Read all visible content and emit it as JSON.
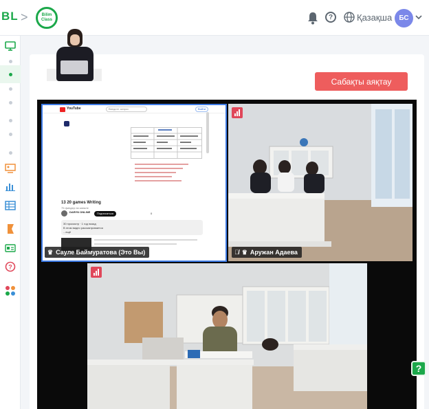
{
  "header": {
    "bl_logo": "BL",
    "breadcrumb_separator": ">",
    "bilim_logo_line1": "Bilim",
    "bilim_logo_line2": "Class",
    "help_glyph": "?",
    "language": "Қазақша",
    "avatar_initials": "БС",
    "icons": [
      "bell-icon",
      "help-icon",
      "globe-icon",
      "chevron-down-icon"
    ]
  },
  "sidebar": {
    "icons": [
      "monitor-icon",
      "presentation-icon",
      "bar-chart-icon",
      "table-icon",
      "bookmark-icon",
      "id-card-icon",
      "help-circle-icon",
      "apps-icon"
    ],
    "colors": {
      "green": "#1ba84a",
      "orange": "#f0913a",
      "blue": "#3a8fd6",
      "red": "#e0475a"
    }
  },
  "lesson": {
    "end_button": "Сабақты аяқтау",
    "end_button_color": "#ee5d5d"
  },
  "participants": [
    {
      "name": "Сауле Баймуратова (Это Вы)",
      "role": "host",
      "sharing_screen": true
    },
    {
      "name": "Аружан Адаева",
      "role": "host",
      "mic_muted": true
    },
    {
      "name": "",
      "role": "participant"
    }
  ],
  "screen_share": {
    "site": "YouTube",
    "search_placeholder": "Введите запрос",
    "sign_in": "Войти",
    "video_title": "13 20 games Writing",
    "video_meta": "75 финдер на канале",
    "channel_name": "DARYN ONLINE",
    "subscribe": "Подписаться",
    "description_lines": [
      "30 просмотр · 1 год назад",
      "В этом видео рассматривается",
      "...ещё"
    ],
    "likes": "0"
  },
  "floating_help": "?"
}
